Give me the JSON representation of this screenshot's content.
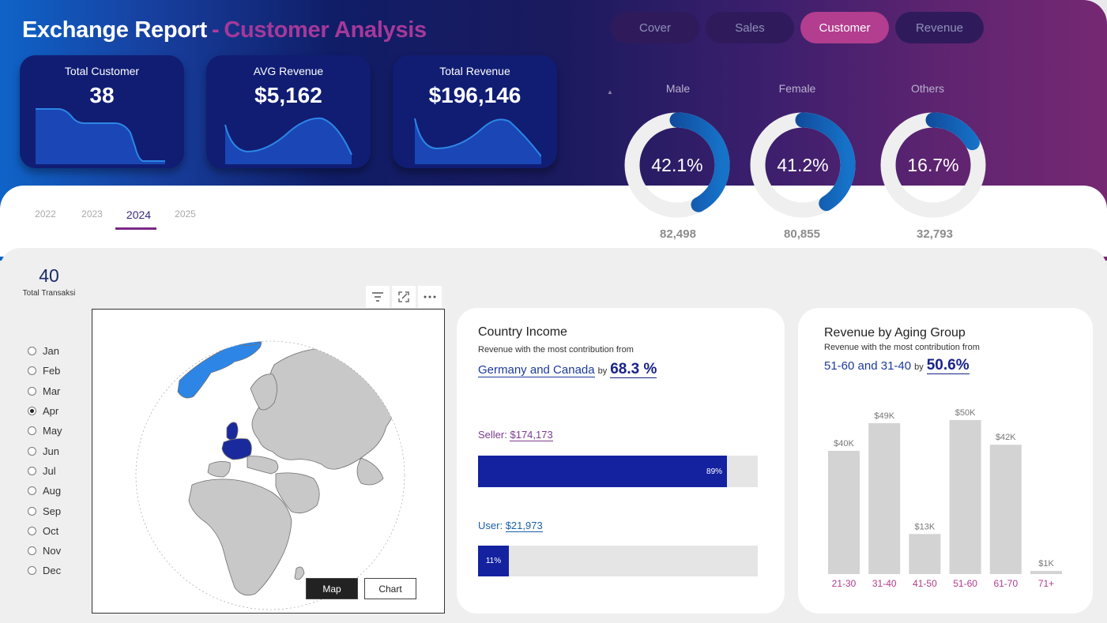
{
  "header": {
    "title_main": "Exchange Report",
    "title_sep": "-",
    "title_sub": "Customer Analysis"
  },
  "nav": [
    {
      "label": "Cover",
      "active": false
    },
    {
      "label": "Sales",
      "active": false
    },
    {
      "label": "Customer",
      "active": true
    },
    {
      "label": "Revenue",
      "active": false
    }
  ],
  "kpis": [
    {
      "label": "Total Customer",
      "value": "38"
    },
    {
      "label": "AVG Revenue",
      "value": "$5,162"
    },
    {
      "label": "Total Revenue",
      "value": "$196,146"
    }
  ],
  "gender": [
    {
      "label": "Male",
      "percent": "42.1%",
      "share": 0.421,
      "count": "82,498"
    },
    {
      "label": "Female",
      "percent": "41.2%",
      "share": 0.412,
      "count": "80,855"
    },
    {
      "label": "Others",
      "percent": "16.7%",
      "share": 0.167,
      "count": "32,793"
    }
  ],
  "years": {
    "items": [
      "2022",
      "2023",
      "2024",
      "2025"
    ],
    "selected": "2024"
  },
  "total_transaksi": {
    "value": "40",
    "label": "Total Transaksi"
  },
  "months": {
    "items": [
      "Jan",
      "Feb",
      "Mar",
      "Apr",
      "May",
      "Jun",
      "Jul",
      "Aug",
      "Sep",
      "Oct",
      "Nov",
      "Dec"
    ],
    "selected": "Apr"
  },
  "map": {
    "toggle": [
      "Map",
      "Chart"
    ],
    "active": "Map",
    "highlight_color": "#1a2a9c",
    "highlight_light": "#2d86e6",
    "land_color": "#c8c8c8"
  },
  "country_income": {
    "title": "Country Income",
    "subtitle": "Revenue with the most contribution from",
    "highlight": "Germany and Canada",
    "by": "by",
    "percent": "68.3 %",
    "seller": {
      "label": "Seller:",
      "value": "$174,173",
      "pct_label": "89%",
      "share": 0.89
    },
    "user": {
      "label": "User:",
      "value": "$21,973",
      "pct_label": "11%",
      "share": 0.11
    }
  },
  "aging": {
    "title": "Revenue by Aging Group",
    "subtitle": "Revenue with the most contribution from",
    "highlight": "51-60 and 31-40",
    "by": "by",
    "percent": "50.6%"
  },
  "chart_data": {
    "type": "bar",
    "title": "Revenue by Aging Group",
    "categories": [
      "21-30",
      "31-40",
      "41-50",
      "51-60",
      "61-70",
      "71+"
    ],
    "values": [
      40,
      49,
      13,
      50,
      42,
      1
    ],
    "data_labels": [
      "$40K",
      "$49K",
      "$13K",
      "$50K",
      "$42K",
      "$1K"
    ],
    "ylim": [
      0,
      50
    ],
    "bar_color": "#d3d3d3",
    "label_color": "#b03b8e"
  },
  "colors": {
    "accent": "#b33d8e",
    "navy": "#101d73",
    "bar_blue": "#1422a0"
  }
}
